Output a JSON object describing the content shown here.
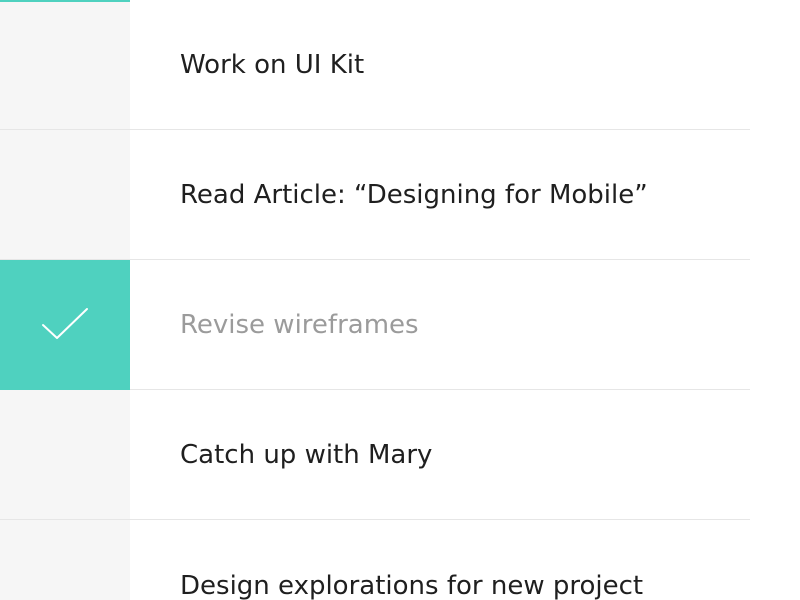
{
  "tasks": [
    {
      "label": "Work on UI Kit",
      "completed": false
    },
    {
      "label": "Read Article: “Designing for Mobile”",
      "completed": false
    },
    {
      "label": "Revise wireframes",
      "completed": true
    },
    {
      "label": "Catch up with Mary",
      "completed": false
    },
    {
      "label": "Design explorations for new project",
      "completed": false
    }
  ],
  "colors": {
    "accent": "#4fd1bf",
    "gutter": "#f6f6f6",
    "text": "#1f1f1f",
    "completed_text": "#9b9b9b",
    "divider": "#e6e6e6"
  }
}
